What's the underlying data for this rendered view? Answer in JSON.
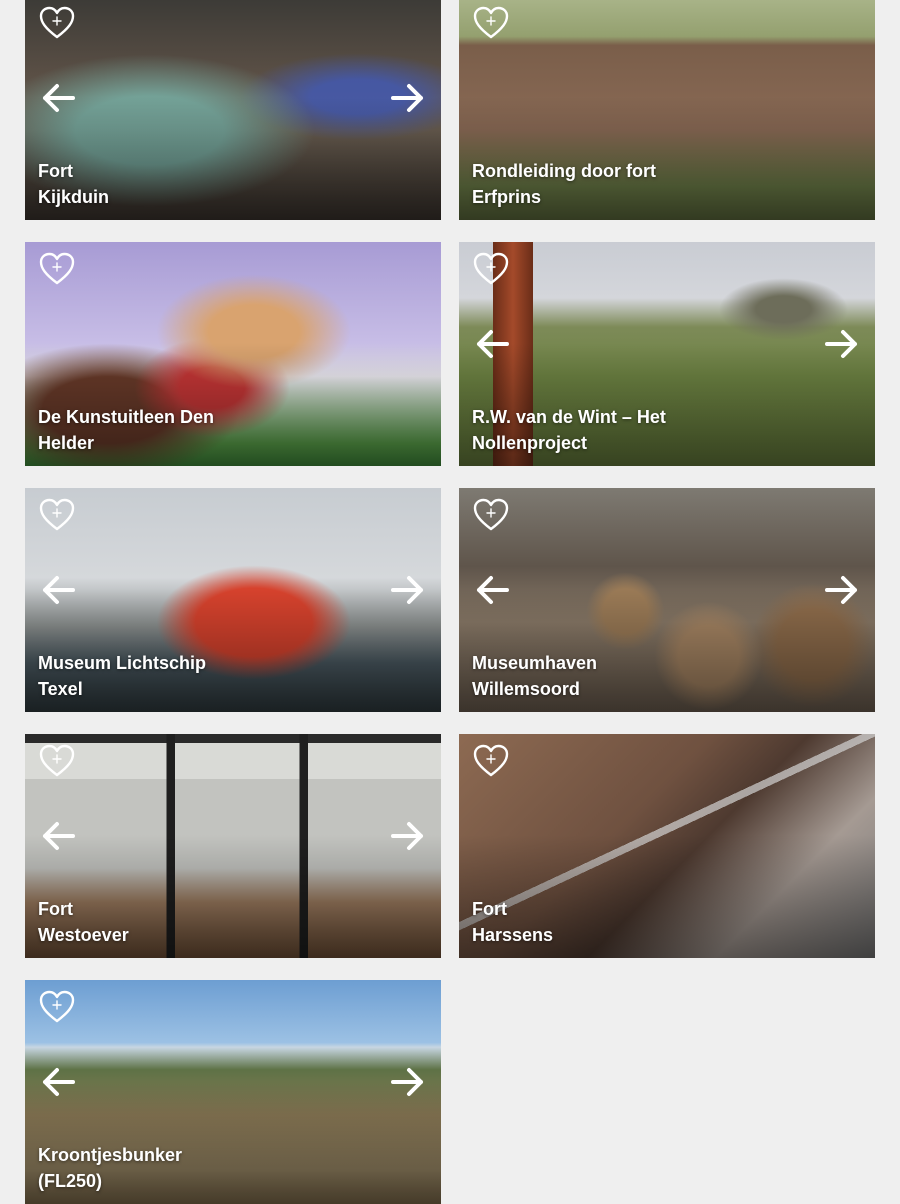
{
  "cards": [
    {
      "title_line1": "Fort",
      "title_line2": "Kijkduin",
      "show_prev": true,
      "show_next": true
    },
    {
      "title_line1": "Rondleiding door fort",
      "title_line2": "Erfprins",
      "show_prev": false,
      "show_next": false
    },
    {
      "title_line1": "De Kunstuitleen Den",
      "title_line2": "Helder",
      "show_prev": false,
      "show_next": false
    },
    {
      "title_line1": "R.W. van de Wint – Het",
      "title_line2": "Nollenproject",
      "show_prev": true,
      "show_next": true
    },
    {
      "title_line1": "Museum Lichtschip",
      "title_line2": "Texel",
      "show_prev": true,
      "show_next": true
    },
    {
      "title_line1": "Museumhaven",
      "title_line2": "Willemsoord",
      "show_prev": true,
      "show_next": true
    },
    {
      "title_line1": "Fort",
      "title_line2": "Westoever",
      "show_prev": true,
      "show_next": true
    },
    {
      "title_line1": "Fort",
      "title_line2": "Harssens",
      "show_prev": false,
      "show_next": false
    },
    {
      "title_line1": "Kroontjesbunker",
      "title_line2": "(FL250)",
      "show_prev": true,
      "show_next": true
    }
  ],
  "icons": {
    "favorite": "heart-plus-icon",
    "previous": "arrow-left-icon",
    "next": "arrow-right-icon"
  },
  "colors": {
    "page_background": "#efefef",
    "overlay_text": "#ffffff"
  }
}
